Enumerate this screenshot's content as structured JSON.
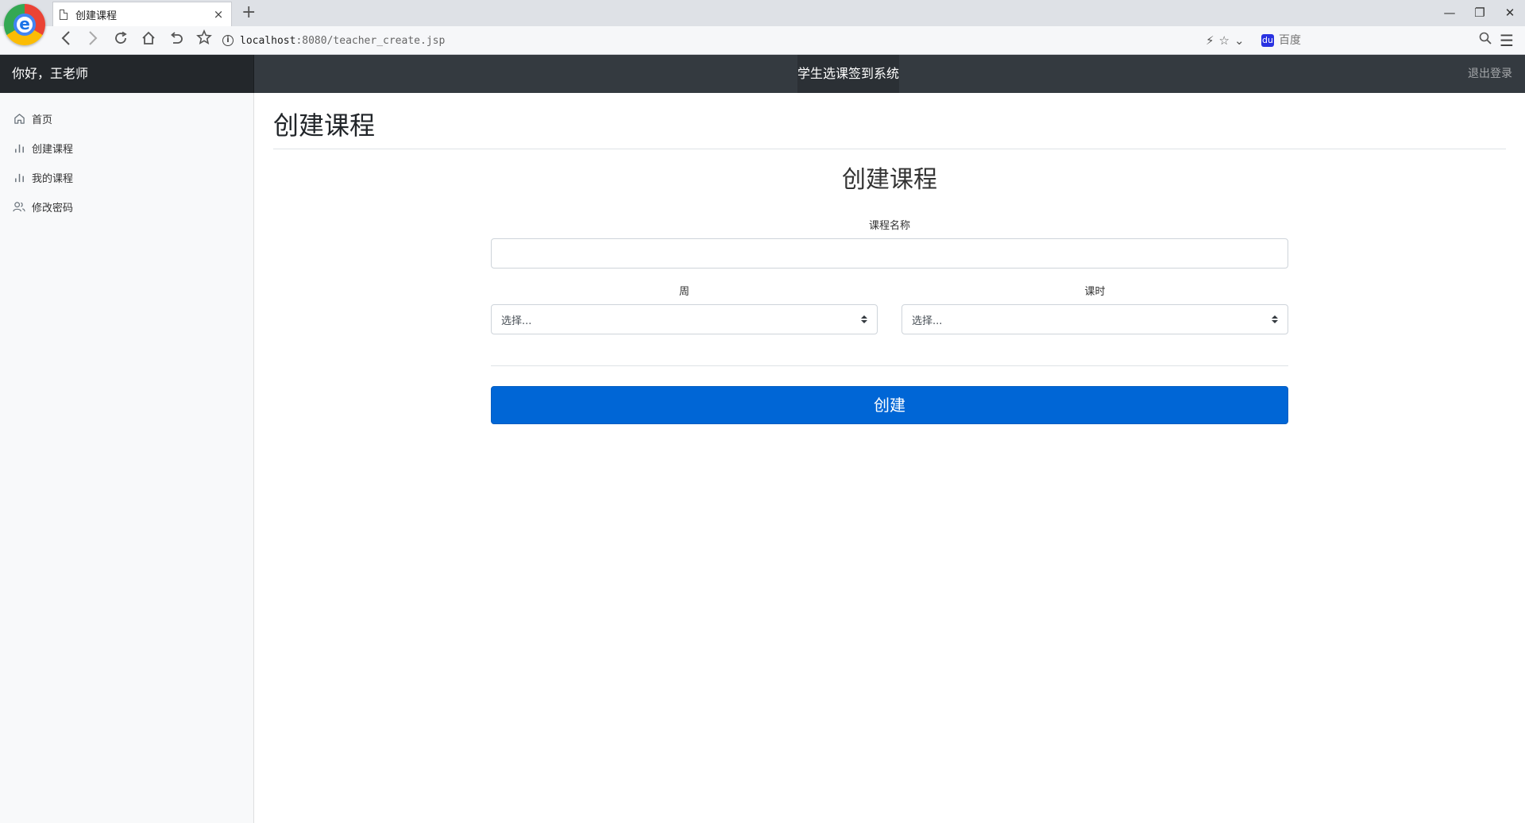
{
  "browser": {
    "tab_title": "创建课程",
    "tab_close": "×",
    "new_tab": "+",
    "url_host": "localhost",
    "url_rest": ":8080/teacher_create.jsp",
    "search_placeholder": "百度",
    "window_controls": {
      "minimize": "—",
      "restore": "❐",
      "close": "✕"
    }
  },
  "header": {
    "greeting": "你好，王老师",
    "system_title": "学生选课签到系统",
    "logout": "退出登录"
  },
  "sidebar": {
    "items": [
      {
        "label": "首页",
        "icon": "home-icon"
      },
      {
        "label": "创建课程",
        "icon": "bar-chart-icon"
      },
      {
        "label": "我的课程",
        "icon": "bar-chart-icon"
      },
      {
        "label": "修改密码",
        "icon": "users-icon"
      }
    ]
  },
  "main": {
    "page_title": "创建课程",
    "form": {
      "title": "创建课程",
      "course_name_label": "课程名称",
      "course_name_value": "",
      "week_label": "周",
      "week_selected": "选择...",
      "hours_label": "课时",
      "hours_selected": "选择...",
      "submit_label": "创建"
    }
  },
  "colors": {
    "header_bg": "#343a40",
    "brand_bg": "#23272b",
    "sidebar_bg": "#f8f9fa",
    "primary": "#0066d6"
  }
}
